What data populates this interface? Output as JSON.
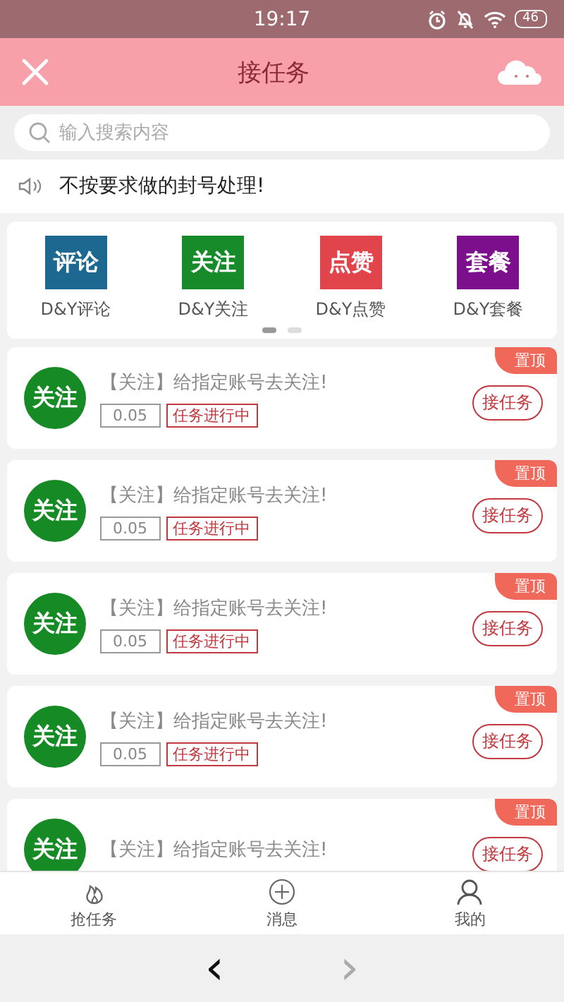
{
  "status_bar": {
    "time": "19:17",
    "battery": "46"
  },
  "header": {
    "title": "接任务"
  },
  "search": {
    "placeholder": "输入搜索内容"
  },
  "notice": {
    "text": "不按要求做的封号处理!"
  },
  "categories": [
    {
      "icon_text": "评论",
      "label": "D&Y评论",
      "color": "#1d6890"
    },
    {
      "icon_text": "关注",
      "label": "D&Y关注",
      "color": "#178a2a"
    },
    {
      "icon_text": "点赞",
      "label": "D&Y点赞",
      "color": "#e2444c"
    },
    {
      "icon_text": "套餐",
      "label": "D&Y套餐",
      "color": "#7b0f8c"
    }
  ],
  "pager": [
    {
      "selected": true
    },
    {
      "selected": false
    }
  ],
  "tasks": [
    {
      "badge": "置顶",
      "logo": "关注",
      "title": "【关注】给指定账号去关注!",
      "price": "0.05",
      "status": "任务进行中",
      "button": "接任务"
    },
    {
      "badge": "置顶",
      "logo": "关注",
      "title": "【关注】给指定账号去关注!",
      "price": "0.05",
      "status": "任务进行中",
      "button": "接任务"
    },
    {
      "badge": "置顶",
      "logo": "关注",
      "title": "【关注】给指定账号去关注!",
      "price": "0.05",
      "status": "任务进行中",
      "button": "接任务"
    },
    {
      "badge": "置顶",
      "logo": "关注",
      "title": "【关注】给指定账号去关注!",
      "price": "0.05",
      "status": "任务进行中",
      "button": "接任务"
    },
    {
      "badge": "置顶",
      "logo": "关注",
      "title": "【关注】给指定账号去关注!",
      "button": "接任务"
    }
  ],
  "tab_bar": [
    {
      "kind": "fire",
      "label": "抢任务"
    },
    {
      "kind": "plus",
      "label": "消息"
    },
    {
      "kind": "person",
      "label": "我的"
    }
  ],
  "browser_nav": {
    "back": "‹",
    "forward": "›"
  }
}
